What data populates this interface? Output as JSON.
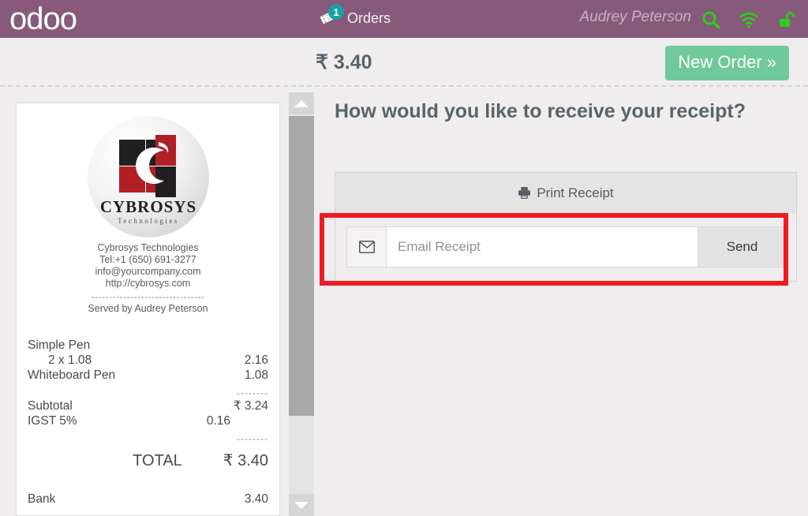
{
  "header": {
    "logo_text": "odoo",
    "orders_label": "Orders",
    "orders_badge_count": "1",
    "cashier_name": "Audrey Peterson",
    "icons": [
      "orders-ticket-icon",
      "search-icon",
      "wifi-icon",
      "unlock-icon"
    ],
    "background_color": "#875a7b",
    "icon_color": "#2ecc1b",
    "badge_color": "#17a2a2"
  },
  "subheader": {
    "order_total": "₹ 3.40",
    "new_order_label": "New Order »",
    "new_order_color": "#70c99a"
  },
  "receipt": {
    "logo_name": "cybrosys-logo",
    "logo_title": "CYBROSYS",
    "logo_subtitle": "Technologies",
    "company_name": "Cybrosys Technologies",
    "phone": "Tel:+1 (650) 691-3277",
    "email": "info@yourcompany.com",
    "website": "http://cybrosys.com",
    "separator": "--------------------------------",
    "served_by": "Served by Audrey Peterson",
    "lines": [
      {
        "name": "Simple Pen",
        "qty_text": "",
        "amount": ""
      },
      {
        "name": "",
        "qty_text": "2 x 1.08",
        "amount": "2.16"
      },
      {
        "name": "Whiteboard Pen",
        "qty_text": "",
        "amount": "1.08"
      }
    ],
    "items": [
      {
        "product": "Simple Pen",
        "detail": "2 x 1.08",
        "amount": "2.16"
      },
      {
        "product": "Whiteboard Pen",
        "detail": "",
        "amount": "1.08"
      }
    ],
    "rule": "--------",
    "subtotal_label": "Subtotal",
    "subtotal_value": "₹ 3.24",
    "tax_label": "IGST 5%",
    "tax_value": "0.16",
    "total_rule": "--------",
    "total_label": "TOTAL",
    "total_value": "₹ 3.40",
    "payment_label": "Bank",
    "payment_value": "3.40"
  },
  "scrollbar": {
    "up_icon": "chevron-up-icon",
    "down_icon": "chevron-down-icon"
  },
  "main": {
    "question": "How would you like to receive your receipt?",
    "print_label": "Print Receipt",
    "print_icon": "printer-icon",
    "email_icon": "envelope-icon",
    "email_placeholder": "Email Receipt",
    "email_value": "",
    "send_label": "Send",
    "highlight_color": "#ee1b24"
  }
}
